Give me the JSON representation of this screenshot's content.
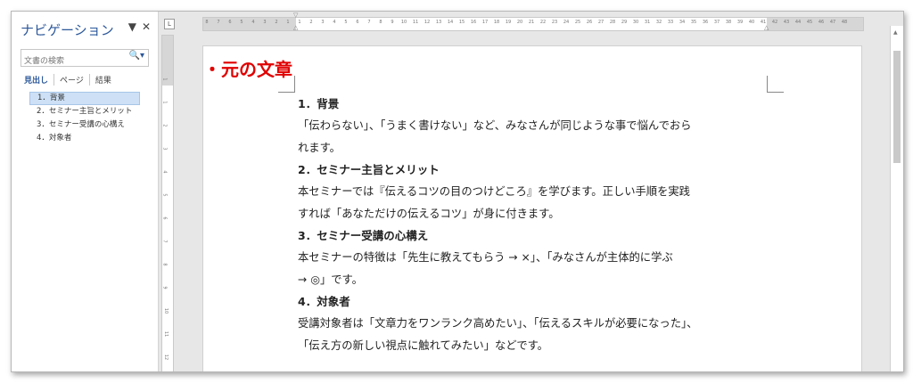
{
  "nav": {
    "title": "ナビゲーション",
    "dropdown_glyph": "▼",
    "close_glyph": "✕",
    "search_placeholder": "文書の検索",
    "search_glyph": "🔍▾",
    "tabs": [
      "見出し",
      "ページ",
      "結果"
    ],
    "items": [
      "1．背景",
      "2．セミナー主旨とメリット",
      "3．セミナー受講の心構え",
      "4．対象者"
    ]
  },
  "ruler": {
    "corner_glyph": "L",
    "h_numbers": [
      "8",
      "7",
      "6",
      "5",
      "4",
      "3",
      "2",
      "1",
      "1",
      "2",
      "3",
      "4",
      "5",
      "6",
      "7",
      "8",
      "9",
      "10",
      "11",
      "12",
      "13",
      "14",
      "15",
      "16",
      "17",
      "18",
      "19",
      "20",
      "21",
      "22",
      "23",
      "24",
      "25",
      "26",
      "27",
      "28",
      "29",
      "30",
      "31",
      "32",
      "33",
      "34",
      "35",
      "36",
      "37",
      "38",
      "39",
      "40",
      "41",
      "42",
      "43",
      "44",
      "45",
      "46",
      "47",
      "48"
    ],
    "v_numbers": [
      "1",
      "1",
      "2",
      "3",
      "4",
      "5",
      "6",
      "7",
      "8",
      "9",
      "10",
      "11",
      "12",
      "13"
    ]
  },
  "document": {
    "main_heading": "・元の文章",
    "sections": [
      {
        "heading": "1．背景",
        "lines": [
          "「伝わらない」、「うまく書けない」など、みなさんが同じような事で悩んでおら",
          "れます。"
        ]
      },
      {
        "heading": "2．セミナー主旨とメリット",
        "lines": [
          "本セミナーでは『伝えるコツの目のつけどころ』を学びます。正しい手順を実践",
          "すれば「あなただけの伝えるコツ」が身に付きます。"
        ]
      },
      {
        "heading": "3．セミナー受講の心構え",
        "lines": [
          "本セミナーの特徴は「先生に教えてもらう → ×」、「みなさんが主体的に学ぶ",
          "→ ◎」です。"
        ]
      },
      {
        "heading": "4．対象者",
        "lines": [
          "受講対象者は「文章力をワンランク高めたい」、「伝えるスキルが必要になった」、",
          "「伝え方の新しい視点に触れてみたい」などです。"
        ]
      }
    ]
  },
  "colors": {
    "accent": "#2b579a",
    "heading_red": "#e00000",
    "nav_selected": "#cde0f5"
  }
}
